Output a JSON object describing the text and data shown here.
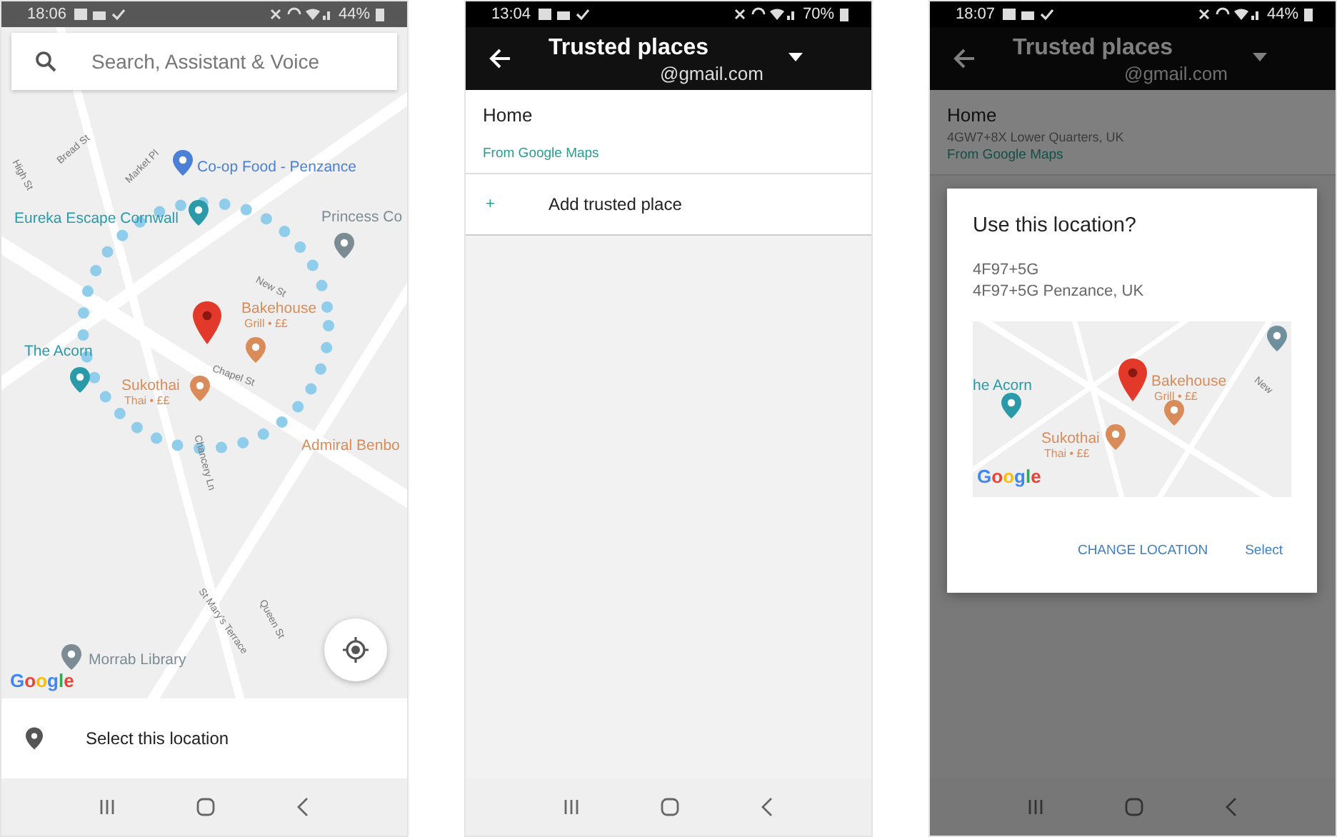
{
  "phones": [
    {
      "kind": "map_picker",
      "status_bar": {
        "time": "18:06",
        "battery": "44%"
      },
      "search": {
        "placeholder": "Search, Assistant & Voice"
      },
      "map": {
        "places": [
          {
            "text": "Co-op Food - Penzance",
            "color": "#4a80d6"
          },
          {
            "text": "Eureka Escape Cornwall",
            "color": "#2a9aa8"
          },
          {
            "text": "Princess Co",
            "color": "#7b8c95"
          },
          {
            "text": "Bakehouse",
            "subtitle": "Grill • ££",
            "color": "#d98c5a"
          },
          {
            "text": "The Acorn",
            "color": "#2a9aa8"
          },
          {
            "text": "Sukothai",
            "subtitle": "Thai • ££",
            "color": "#d98c5a"
          },
          {
            "text": "Admiral Benbo",
            "color": "#d98c5a"
          },
          {
            "text": "Morrab Library",
            "color": "#7b8c95"
          }
        ],
        "streets": [
          "High St",
          "Bread St",
          "Market Pl",
          "New St",
          "Chapel St",
          "Chancery Ln",
          "Queen St",
          "St Mary's Terrace"
        ],
        "logo": "Google"
      },
      "bottom_action": "Select this location"
    },
    {
      "kind": "trusted_places",
      "status_bar": {
        "time": "13:04",
        "battery": "70%"
      },
      "app_bar": {
        "title": "Trusted places",
        "account": "@gmail.com"
      },
      "places": [
        {
          "title": "Home",
          "source": "From Google Maps"
        }
      ],
      "add_action": {
        "icon": "+",
        "label": "Add trusted place"
      }
    },
    {
      "kind": "trusted_places",
      "status_bar": {
        "time": "18:07",
        "battery": "44%"
      },
      "app_bar": {
        "title": "Trusted places",
        "account": "@gmail.com"
      },
      "places": [
        {
          "title": "Home",
          "address": "4GW7+8X Lower Quarters, UK",
          "source": "From Google Maps"
        }
      ],
      "dialog": {
        "title": "Use this location?",
        "lines": [
          "4F97+5G",
          "4F97+5G Penzance, UK"
        ],
        "map": {
          "places": [
            {
              "text": "he Acorn",
              "color": "#2a9aa8"
            },
            {
              "text": "Bakehouse",
              "subtitle": "Grill • ££",
              "color": "#d98c5a"
            },
            {
              "text": "Sukothai",
              "subtitle": "Thai • ££",
              "color": "#d98c5a"
            }
          ],
          "streets": [
            "New"
          ],
          "logo": "Google"
        },
        "buttons": [
          "CHANGE LOCATION",
          "Select"
        ]
      }
    }
  ]
}
